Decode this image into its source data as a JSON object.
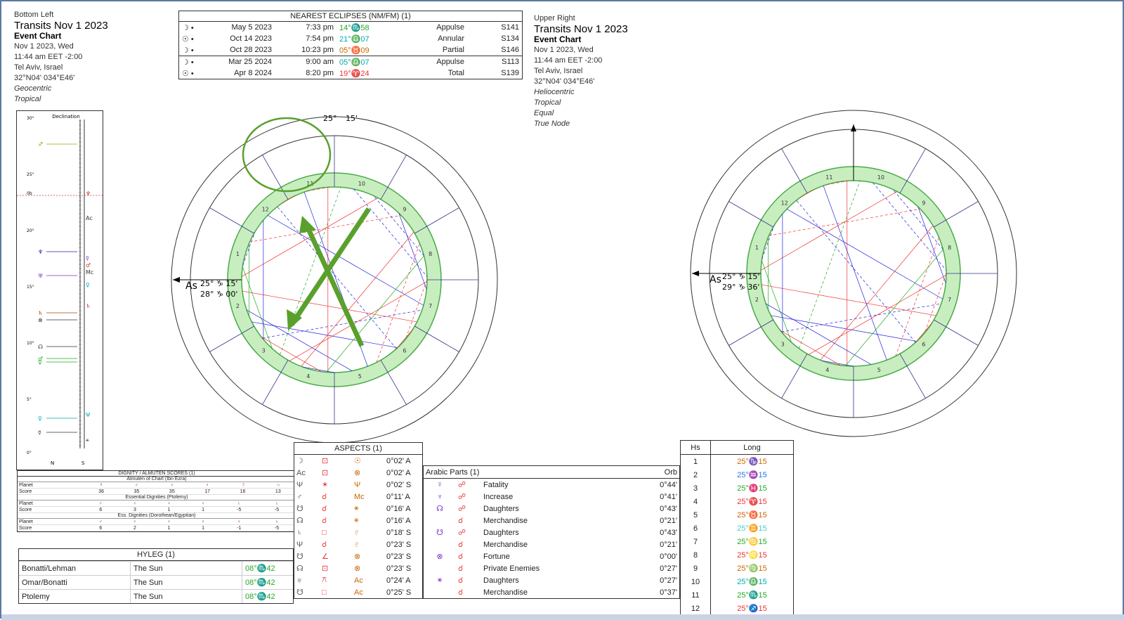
{
  "left_header": {
    "position": "Bottom Left",
    "title": "Transits Nov 1 2023",
    "chart_type": "Event Chart",
    "date": "Nov 1 2023, Wed",
    "time": "11:44 am  EET -2:00",
    "place": "Tel Aviv, Israel",
    "coords": "32°N04' 034°E46'",
    "system1": "Geocentric",
    "system2": "Tropical"
  },
  "right_header": {
    "position": "Upper Right",
    "title": "Transits Nov 1 2023",
    "chart_type": "Event Chart",
    "date": "Nov 1 2023, Wed",
    "time": "11:44 am  EET -2:00",
    "place": "Tel Aviv, Israel",
    "coords": "32°N04' 034°E46'",
    "system1": "Heliocentric",
    "system2": "Tropical",
    "system3": "Equal",
    "system4": "True Node"
  },
  "eclipses": {
    "title": "NEAREST ECLIPSES (NM/FM) (1)",
    "rows": [
      {
        "glyph": "☽ •",
        "date": "May 5 2023",
        "time": "7:33 pm",
        "pos": "14°♏58",
        "type": "Appulse",
        "saros": "S141",
        "color": "#22aa22"
      },
      {
        "glyph": "☉ •",
        "date": "Oct 14 2023",
        "time": "7:54 pm",
        "pos": "21°♎07",
        "type": "Annular",
        "saros": "S134",
        "color": "#00aaaa"
      },
      {
        "glyph": "☽ •",
        "date": "Oct 28 2023",
        "time": "10:23 pm",
        "pos": "05°♉09",
        "type": "Partial",
        "saros": "S146",
        "color": "#cc6600"
      },
      {
        "glyph": "☽ •",
        "date": "Mar 25 2024",
        "time": "9:00 am",
        "pos": "05°♎07",
        "type": "Appulse",
        "saros": "S113",
        "color": "#00aaaa"
      },
      {
        "glyph": "☉ •",
        "date": "Apr 8 2024",
        "time": "8:20 pm",
        "pos": "19°♈24",
        "type": "Total",
        "saros": "S139",
        "color": "#ee3333"
      }
    ]
  },
  "aspects": {
    "title": "ASPECTS (1)",
    "rows": [
      {
        "p1": "☽",
        "a": "⊡",
        "p2": "☉",
        "orb": "0°02' A"
      },
      {
        "p1": "Ac",
        "a": "⊡",
        "p2": "⊗",
        "orb": "0°02' A"
      },
      {
        "p1": "Ψ",
        "a": "✶",
        "p2": "Ψ",
        "orb": "0°02' S"
      },
      {
        "p1": "♂",
        "a": "☌",
        "p2": "Mc",
        "orb": "0°11' A"
      },
      {
        "p1": "☋",
        "a": "☌",
        "p2": "⚹",
        "orb": "0°16' A"
      },
      {
        "p1": "☊",
        "a": "☌",
        "p2": "⚹",
        "orb": "0°16' A"
      },
      {
        "p1": "♄",
        "a": "□",
        "p2": "♇",
        "orb": "0°18' S"
      },
      {
        "p1": "Ψ",
        "a": "☌",
        "p2": "♇",
        "orb": "0°23' S"
      },
      {
        "p1": "☋",
        "a": "∠",
        "p2": "⊗",
        "orb": "0°23' S"
      },
      {
        "p1": "☊",
        "a": "⊡",
        "p2": "⊗",
        "orb": "0°23' S"
      },
      {
        "p1": "♅",
        "a": "⚻",
        "p2": "Ac",
        "orb": "0°24' A"
      },
      {
        "p1": "☋",
        "a": "□",
        "p2": "Ac",
        "orb": "0°25' S"
      }
    ]
  },
  "arabic": {
    "title": "Arabic Parts (1)",
    "orb_label": "Orb",
    "rows": [
      {
        "g1": "☿",
        "g2": "☍",
        "name": "Fatality",
        "orb": "0°44'"
      },
      {
        "g1": "♆",
        "g2": "☍",
        "name": "Increase",
        "orb": "0°41'"
      },
      {
        "g1": "☊",
        "g2": "☍",
        "name": "Daughters",
        "orb": "0°43'"
      },
      {
        "g1": "",
        "g2": "☌",
        "name": "Merchandise",
        "orb": "0°21'"
      },
      {
        "g1": "☋",
        "g2": "☍",
        "name": "Daughters",
        "orb": "0°43'"
      },
      {
        "g1": "",
        "g2": "☌",
        "name": "Merchandise",
        "orb": "0°21'"
      },
      {
        "g1": "⊗",
        "g2": "☌",
        "name": "Fortune",
        "orb": "0°00'"
      },
      {
        "g1": "",
        "g2": "☌",
        "name": "Private Enemies",
        "orb": "0°27'"
      },
      {
        "g1": "⚹",
        "g2": "☌",
        "name": "Daughters",
        "orb": "0°27'"
      },
      {
        "g1": "",
        "g2": "☌",
        "name": "Merchandise",
        "orb": "0°37'"
      }
    ]
  },
  "houses": {
    "col1": "Hs",
    "col2": "Long",
    "rows": [
      {
        "h": "1",
        "v": "25°♑15",
        "c": "#cc6600"
      },
      {
        "h": "2",
        "v": "25°♒15",
        "c": "#2277ee"
      },
      {
        "h": "3",
        "v": "25°♓15",
        "c": "#22aa22"
      },
      {
        "h": "4",
        "v": "25°♈15",
        "c": "#ee3333"
      },
      {
        "h": "5",
        "v": "25°♉15",
        "c": "#cc6600"
      },
      {
        "h": "6",
        "v": "25°♊15",
        "c": "#44cccc"
      },
      {
        "h": "7",
        "v": "25°♋15",
        "c": "#22aa22"
      },
      {
        "h": "8",
        "v": "25°♌15",
        "c": "#ee3333"
      },
      {
        "h": "9",
        "v": "25°♍15",
        "c": "#cc6600"
      },
      {
        "h": "10",
        "v": "25°♎15",
        "c": "#00aaaa"
      },
      {
        "h": "11",
        "v": "25°♏15",
        "c": "#22aa22"
      },
      {
        "h": "12",
        "v": "25°♐15",
        "c": "#ee3333"
      }
    ]
  },
  "hyleg": {
    "title": "HYLEG (1)",
    "rows": [
      {
        "method": "Bonatti/Lehman",
        "body": "The Sun",
        "pos": "08°♏42"
      },
      {
        "method": "Omar/Bonatti",
        "body": "The Sun",
        "pos": "08°♏42"
      },
      {
        "method": "Ptolemy",
        "body": "The Sun",
        "pos": "08°♏42"
      }
    ]
  },
  "dignity": {
    "title": "DIGNITY / ALMUTEN SCORES (1)",
    "sub1": "Almuten of Chart (Ibn Ezra)",
    "sub2": "Essential Dignities (Ptolemy)",
    "sub3": "Ess. Dignities (Dorothean/Egyptian)",
    "planet_label": "Planet",
    "score_label": "Score",
    "r1_planets": [
      "☿",
      "♂",
      "♀",
      "♀",
      "☽",
      "♃"
    ],
    "r1_scores": [
      "36",
      "35",
      "35",
      "17",
      "16",
      "13"
    ],
    "r2_planets": [
      "♂",
      "♀",
      "♀",
      "♀",
      "♄",
      "♄"
    ],
    "r2_scores": [
      "6",
      "3",
      "1",
      "1",
      "-5",
      "-5"
    ],
    "r3_planets": [
      "♂",
      "♀",
      "♀",
      "♀",
      "♀",
      "♄"
    ],
    "r3_scores": [
      "6",
      "2",
      "1",
      "1",
      "-1",
      "-5"
    ]
  },
  "declination": {
    "title": "Declination",
    "ticks": [
      "30°",
      "25°",
      "0b",
      "20°",
      "15°",
      "10°",
      "5°",
      "0°"
    ],
    "n": "N",
    "s": "S",
    "glyphs_left": [
      "♐",
      "♆",
      "♅",
      "♄",
      "⊗",
      "☊",
      "♂",
      "♀",
      "♀",
      "☿"
    ],
    "glyphs_right": [
      "♆",
      "Ac",
      "☿",
      "♂",
      "Mc",
      "♀",
      "♄",
      "Ψ",
      "⚹"
    ]
  },
  "left_chart_labels": {
    "mc_deg": "25°",
    "mc_min": "15'",
    "asc": "As",
    "asc_pos": "25° ♑ 15'",
    "pluto_pos": "28° ♑ 00'"
  },
  "right_chart_labels": {
    "asc": "As",
    "asc_pos": "25° ♑ 15'",
    "pluto_pos": "29° ♑ 36'"
  },
  "colors": {
    "frame": "#5b7aa5",
    "house_ring": "#c8eec0",
    "house_ring_border": "#4aaa4a",
    "annotation_green": "#5aa02c"
  }
}
